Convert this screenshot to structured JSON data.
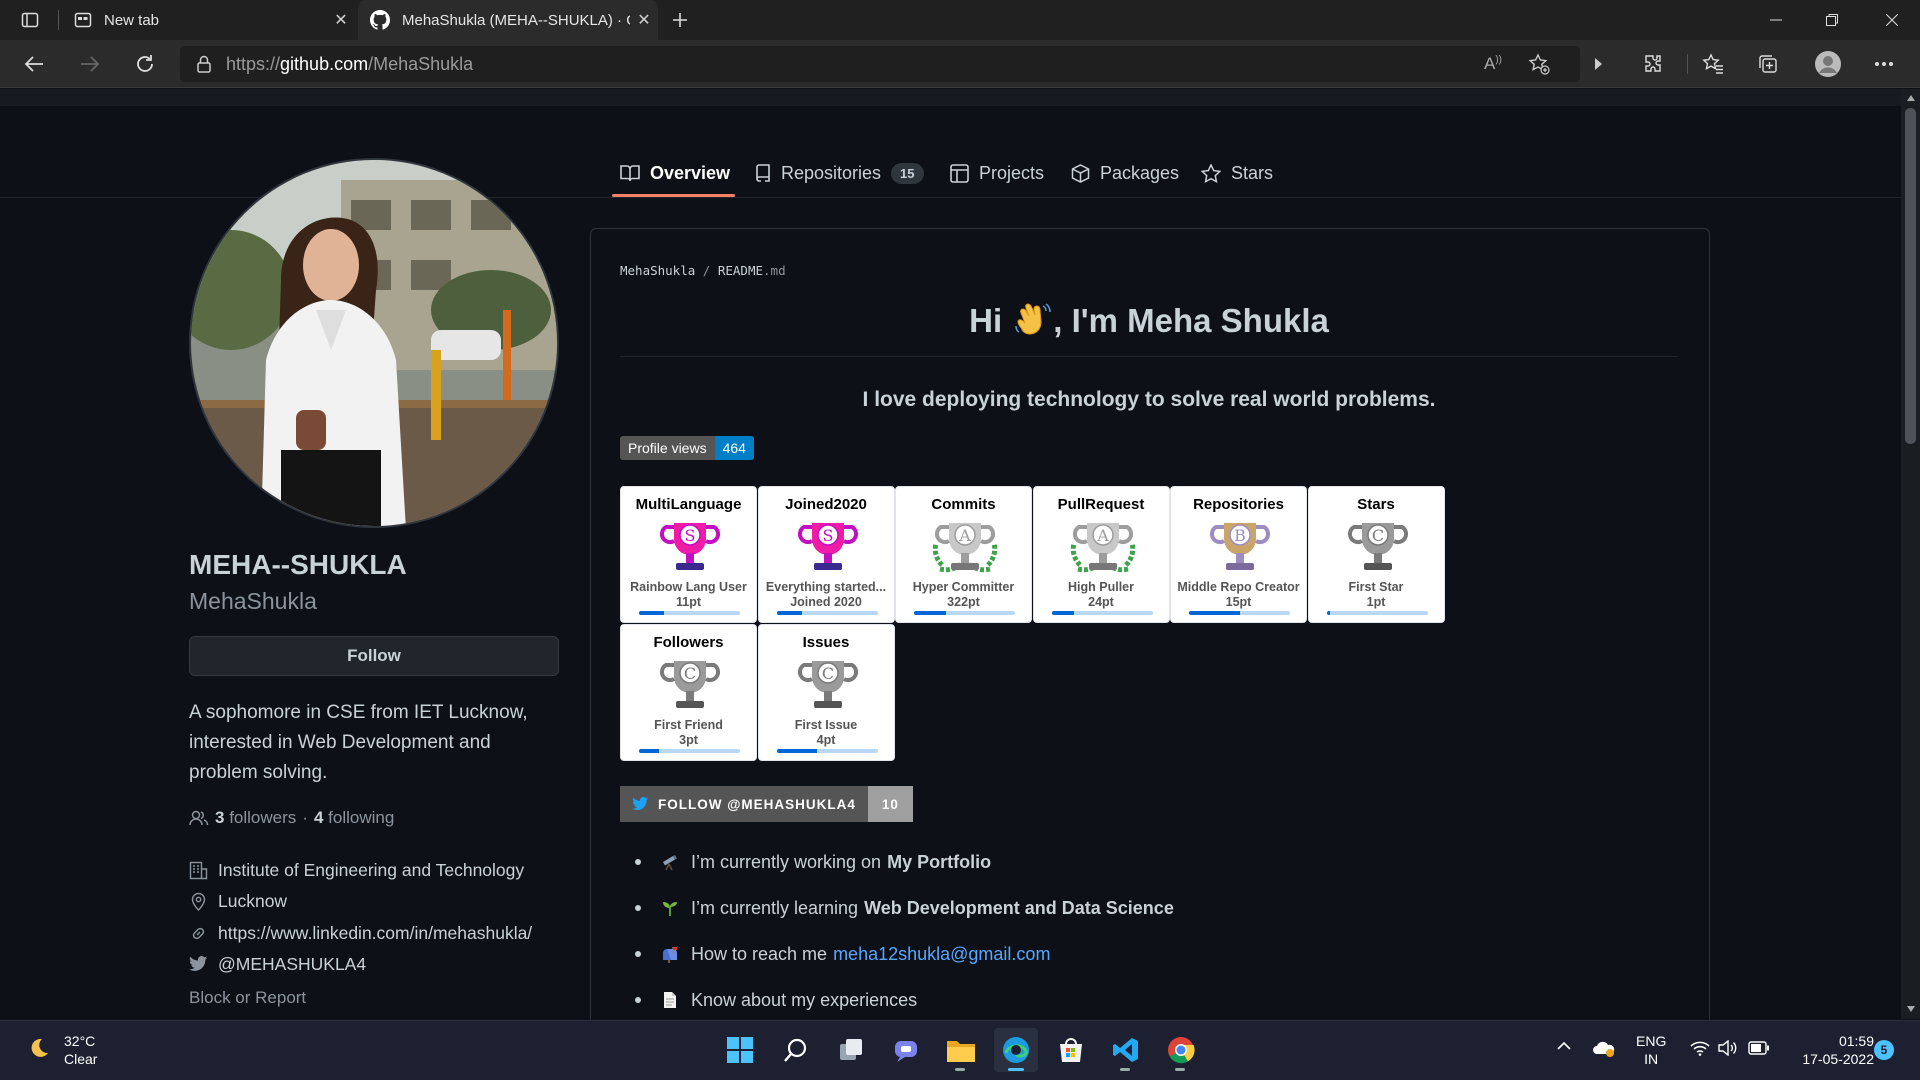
{
  "browser": {
    "tabs": [
      {
        "title": "New tab",
        "icon": "new-tab-icon"
      },
      {
        "title": "MehaShukla (MEHA--SHUKLA) · GitHub",
        "icon": "github-icon",
        "active": true
      }
    ],
    "url_scheme": "https://",
    "url_host": "github.com",
    "url_path": "/MehaShukla"
  },
  "profile_nav": {
    "tabs": [
      {
        "label": "Overview",
        "icon": "book-icon",
        "selected": true
      },
      {
        "label": "Repositories",
        "icon": "repo-icon",
        "count": "15"
      },
      {
        "label": "Projects",
        "icon": "table-icon"
      },
      {
        "label": "Packages",
        "icon": "package-icon"
      },
      {
        "label": "Stars",
        "icon": "star-icon"
      }
    ]
  },
  "profile": {
    "fullname": "MEHA--SHUKLA",
    "username": "MehaShukla",
    "follow_label": "Follow",
    "bio": "A sophomore in CSE from IET Lucknow, interested in Web Development and problem solving.",
    "followers_count": "3",
    "followers_label": "followers",
    "separator": "·",
    "following_count": "4",
    "following_label": "following",
    "organization": "Institute of Engineering and Technology",
    "location": "Lucknow",
    "website": "https://www.linkedin.com/in/mehashukla/",
    "twitter": "@MEHASHUKLA4",
    "block_report": "Block or Report"
  },
  "readme": {
    "path_owner": "MehaShukla",
    "path_sep": "/",
    "path_file": "README",
    "path_ext": ".md",
    "heading_pre": "Hi ",
    "heading_post": ", I'm Meha Shukla",
    "tagline": "I love deploying technology to solve real world problems.",
    "views_label": "Profile views",
    "views_count": "464",
    "trophies": [
      {
        "title": "MultiLanguage",
        "rank": "S",
        "line1": "Rainbow Lang User",
        "line2": "11pt",
        "progress": 0.25
      },
      {
        "title": "Joined2020",
        "rank": "S",
        "line1": "Everything started...",
        "line2": "Joined 2020",
        "progress": 0.25
      },
      {
        "title": "Commits",
        "rank": "A",
        "line1": "Hyper Committer",
        "line2": "322pt",
        "progress": 0.32
      },
      {
        "title": "PullRequest",
        "rank": "A",
        "line1": "High Puller",
        "line2": "24pt",
        "progress": 0.22
      },
      {
        "title": "Repositories",
        "rank": "B",
        "line1": "Middle Repo Creator",
        "line2": "15pt",
        "progress": 0.5
      },
      {
        "title": "Stars",
        "rank": "C",
        "line1": "First Star",
        "line2": "1pt",
        "progress": 0.0
      },
      {
        "title": "Followers",
        "rank": "C",
        "line1": "First Friend",
        "line2": "3pt",
        "progress": 0.2
      },
      {
        "title": "Issues",
        "rank": "C",
        "line1": "First Issue",
        "line2": "4pt",
        "progress": 0.4
      }
    ],
    "twitter_badge_label": "FOLLOW @MEHASHUKLA4",
    "twitter_badge_count": "10",
    "list": [
      {
        "icon": "telescope-icon",
        "text": "I’m currently working on",
        "strong": "My Portfolio"
      },
      {
        "icon": "seedling-icon",
        "text": "I’m currently learning",
        "strong": "Web Development and Data Science"
      },
      {
        "icon": "mailbox-icon",
        "text": "How to reach me",
        "link": "meha12shukla@gmail.com"
      },
      {
        "icon": "document-icon",
        "text": "Know about my experiences"
      }
    ]
  },
  "taskbar": {
    "weather_temp": "32°C",
    "weather_desc": "Clear",
    "lang_1": "ENG",
    "lang_2": "IN",
    "time": "01:59",
    "date": "17-05-2022",
    "notifications": "5"
  }
}
